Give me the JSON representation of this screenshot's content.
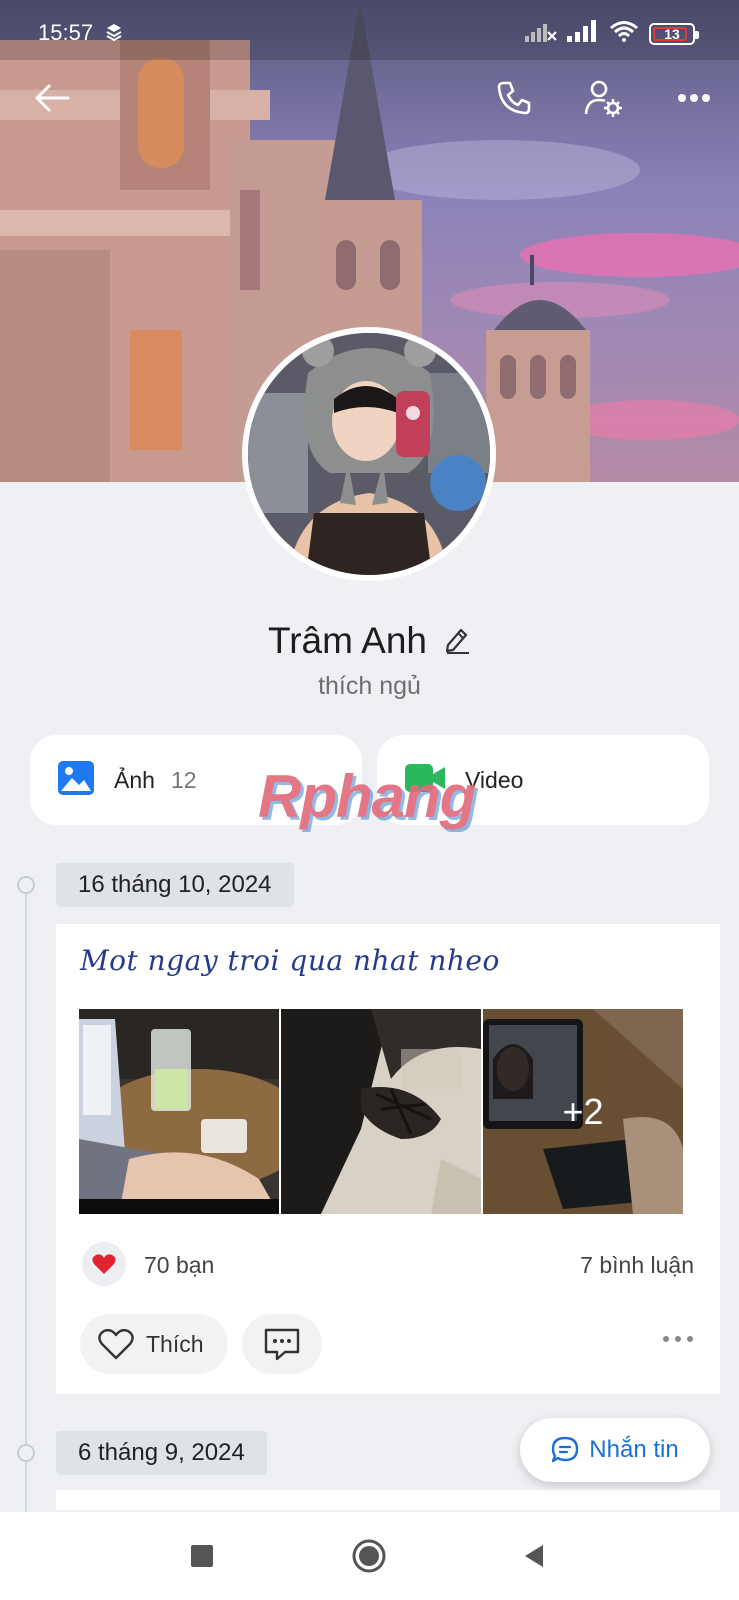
{
  "status_bar": {
    "time": "15:57",
    "battery_level": "13",
    "battery_percent": 13,
    "icons": [
      "sync-icon",
      "no-signal-icon",
      "signal-icon",
      "wifi-icon",
      "battery-icon"
    ]
  },
  "top_bar": {
    "icons": [
      "back-arrow-icon",
      "phone-icon",
      "user-settings-icon",
      "more-dots-icon"
    ]
  },
  "profile": {
    "name": "Trâm Anh",
    "bio": "thích ngủ"
  },
  "media": {
    "photos_label": "Ảnh",
    "photos_count": "12",
    "video_label": "Video"
  },
  "watermark": "Rphang",
  "timeline": [
    {
      "date": "16 tháng 10, 2024",
      "caption": "Mot ngay troi qua nhat nheo",
      "extra_photos": "+2",
      "reactions": "70 bạn",
      "comments": "7 bình luận",
      "like_label": "Thích"
    },
    {
      "date": "6 tháng 9, 2024"
    }
  ],
  "message_button": "Nhắn tin",
  "colors": {
    "accent": "#1a6fd6",
    "background": "#eef0f3",
    "heart": "#e0232e",
    "photo_icon": "#1e78f0",
    "video_icon": "#2bb85c"
  }
}
